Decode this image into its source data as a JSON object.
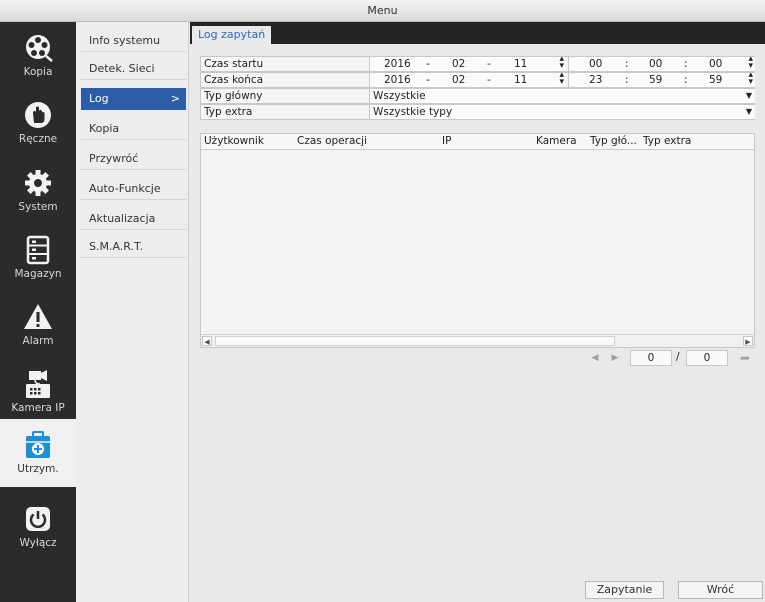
{
  "window": {
    "title": "Menu"
  },
  "nav": {
    "items": [
      {
        "label": "Kopia",
        "icon": "film-reel-icon"
      },
      {
        "label": "Ręczne",
        "icon": "hand-icon"
      },
      {
        "label": "System",
        "icon": "gear-icon"
      },
      {
        "label": "Magazyn",
        "icon": "storage-icon"
      },
      {
        "label": "Alarm",
        "icon": "warning-icon"
      },
      {
        "label": "Kamera IP",
        "icon": "ip-camera-icon"
      },
      {
        "label": "Utrzym.",
        "icon": "maintenance-kit-icon",
        "active": true
      },
      {
        "label": "Wyłącz",
        "icon": "power-icon"
      }
    ]
  },
  "submenu": {
    "items": [
      {
        "label": "Info systemu"
      },
      {
        "label": "Detek. Sieci"
      },
      {
        "label": "Log",
        "active": true,
        "arrow": ">"
      },
      {
        "label": "Kopia"
      },
      {
        "label": "Przywróć"
      },
      {
        "label": "Auto-Funkcje"
      },
      {
        "label": "Aktualizacja"
      },
      {
        "label": "S.M.A.R.T."
      }
    ]
  },
  "tab": {
    "label": "Log zapytań"
  },
  "form": {
    "start": {
      "label": "Czas startu",
      "year": "2016",
      "month": "02",
      "day": "11",
      "hour": "00",
      "minute": "00",
      "second": "00"
    },
    "end": {
      "label": "Czas końca",
      "year": "2016",
      "month": "02",
      "day": "11",
      "hour": "23",
      "minute": "59",
      "second": "59"
    },
    "date_sep": "-",
    "time_sep": ":",
    "main_type": {
      "label": "Typ główny",
      "value": "Wszystkie"
    },
    "extra_type": {
      "label": "Typ extra",
      "value": "Wszystkie typy"
    }
  },
  "table": {
    "columns": [
      "Użytkownik",
      "Czas operacji",
      "IP",
      "Kamera",
      "Typ głó...",
      "Typ extra"
    ],
    "rows": []
  },
  "pager": {
    "current": "0",
    "separator": "/",
    "total": "0"
  },
  "buttons": {
    "query": "Zapytanie",
    "back": "Wróć"
  },
  "colors": {
    "accent": "#2d5da8",
    "tab_text": "#2d6bb8",
    "sidebar_bg": "#2b2b2b"
  }
}
